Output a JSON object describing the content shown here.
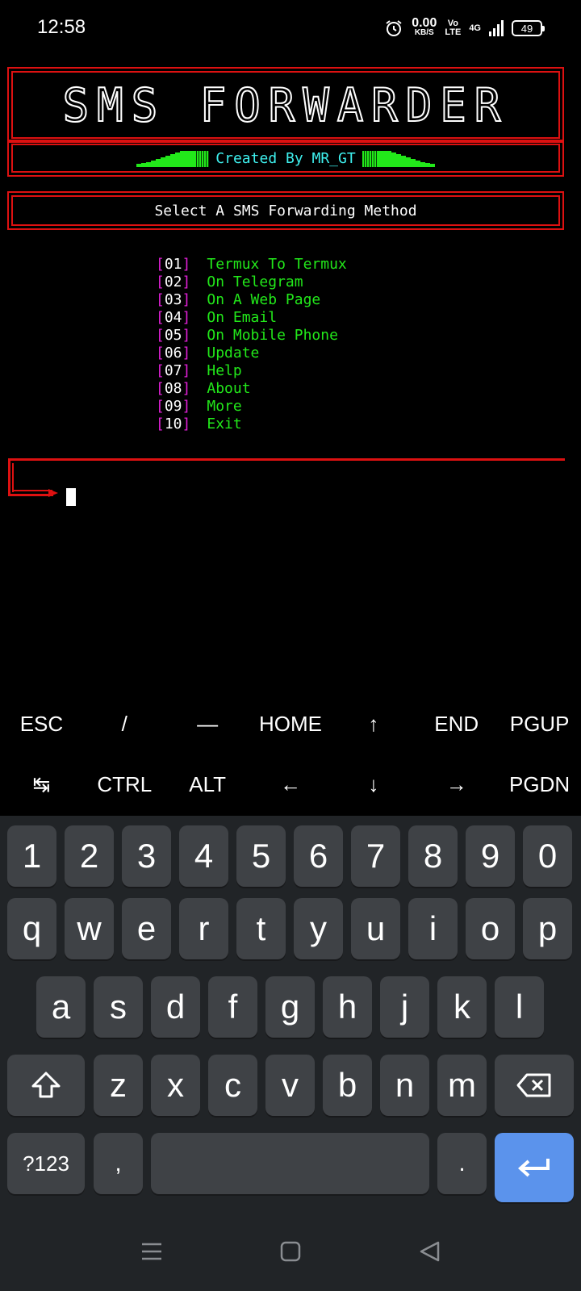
{
  "status_bar": {
    "time": "12:58",
    "net_speed_value": "0.00",
    "net_speed_unit": "KB/S",
    "volte_top": "Vo",
    "volte_bottom": "LTE",
    "network": "4G",
    "battery": "49"
  },
  "terminal": {
    "banner_title": "SMS FORWARDER",
    "credit": "Created By MR_GT",
    "prompt_heading": "Select A SMS Forwarding Method",
    "menu": [
      {
        "num": "01",
        "label": "Termux To Termux"
      },
      {
        "num": "02",
        "label": "On Telegram"
      },
      {
        "num": "03",
        "label": "On A Web Page"
      },
      {
        "num": "04",
        "label": "On Email"
      },
      {
        "num": "05",
        "label": "On Mobile Phone"
      },
      {
        "num": "06",
        "label": "Update"
      },
      {
        "num": "07",
        "label": "Help"
      },
      {
        "num": "08",
        "label": "About"
      },
      {
        "num": "09",
        "label": "More"
      },
      {
        "num": "10",
        "label": "Exit"
      }
    ],
    "colors": {
      "border": "#dd1111",
      "menu_green": "#22e81a",
      "bracket_magenta": "#e020d6",
      "credit_cyan": "#3ef0ee"
    }
  },
  "extra_keys": {
    "row1": [
      "ESC",
      "/",
      "—",
      "HOME",
      "↑",
      "END",
      "PGUP"
    ],
    "row2": [
      "↹",
      "CTRL",
      "ALT",
      "←",
      "↓",
      "→",
      "PGDN"
    ]
  },
  "keyboard": {
    "numbers": [
      "1",
      "2",
      "3",
      "4",
      "5",
      "6",
      "7",
      "8",
      "9",
      "0"
    ],
    "row_q": [
      "q",
      "w",
      "e",
      "r",
      "t",
      "y",
      "u",
      "i",
      "o",
      "p"
    ],
    "row_a": [
      "a",
      "s",
      "d",
      "f",
      "g",
      "h",
      "j",
      "k",
      "l"
    ],
    "row_z": [
      "z",
      "x",
      "c",
      "v",
      "b",
      "n",
      "m"
    ],
    "symbols_key": "?123",
    "comma": ",",
    "period": ".",
    "icons": {
      "shift": "shift-icon",
      "backspace": "backspace-icon",
      "enter": "enter-icon"
    },
    "enter_color": "#5b93ec"
  },
  "nav_bar": {
    "icons": [
      "menu-icon",
      "home-icon",
      "back-icon"
    ]
  }
}
